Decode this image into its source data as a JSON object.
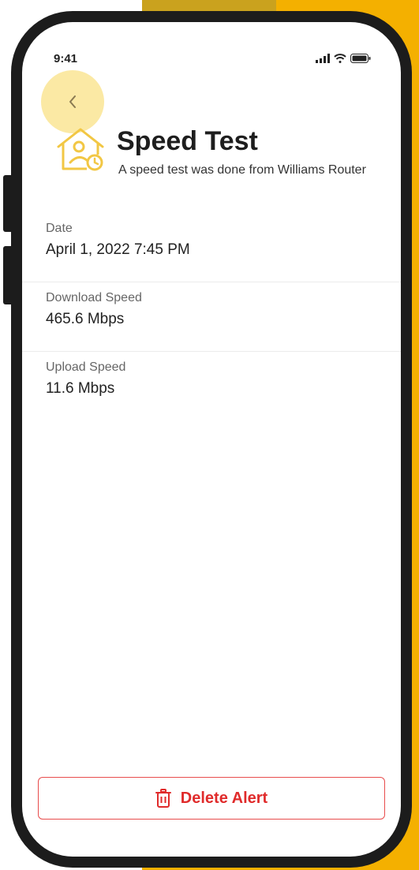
{
  "status_bar": {
    "time": "9:41"
  },
  "header": {
    "title": "Speed Test",
    "subtitle": "A speed test was done from Williams Router"
  },
  "details": [
    {
      "label": "Date",
      "value": "April 1, 2022 7:45 PM"
    },
    {
      "label": "Download Speed",
      "value": "465.6 Mbps"
    },
    {
      "label": "Upload Speed",
      "value": "11.6 Mbps"
    }
  ],
  "actions": {
    "delete_label": "Delete Alert"
  },
  "icons": {
    "back": "chevron-left-icon",
    "header": "house-user-clock-icon",
    "delete": "trash-icon",
    "signal": "cellular-signal-icon",
    "wifi": "wifi-icon",
    "battery": "battery-icon"
  },
  "colors": {
    "accent": "#f4b000",
    "accent_light": "#fbe9a4",
    "icon_yellow": "#f2c744",
    "danger": "#e02b2b"
  }
}
